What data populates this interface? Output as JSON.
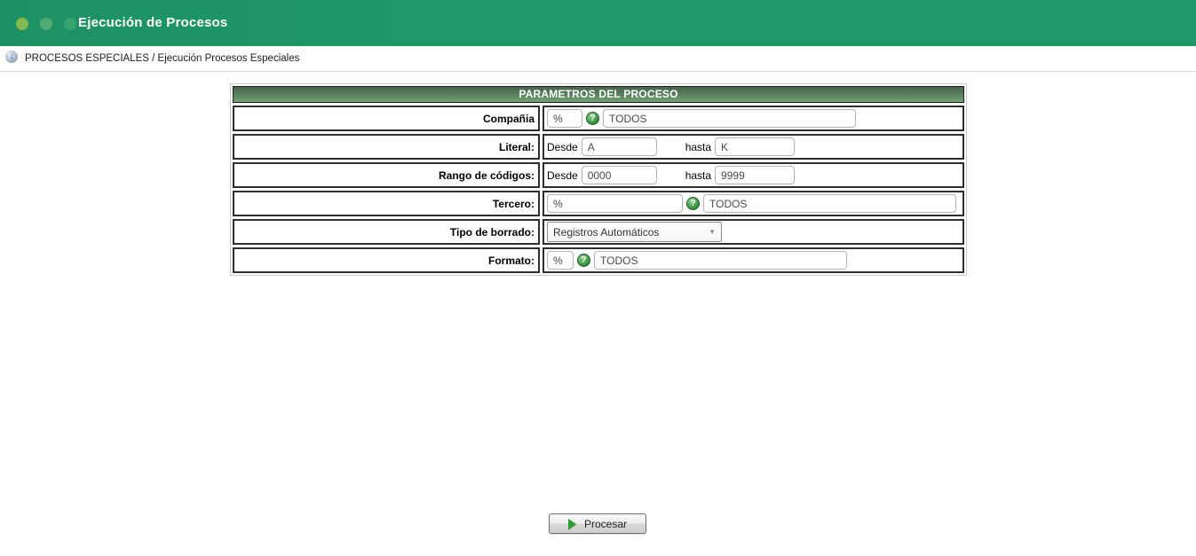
{
  "header": {
    "title": "Ejecución de Procesos"
  },
  "breadcrumb": {
    "text": "PROCESOS ESPECIALES / Ejecución Procesos Especiales"
  },
  "panel": {
    "title": "PARAMETROS DEL PROCESO",
    "rows": {
      "compania": {
        "label": "Compañia",
        "code": "%",
        "desc": "TODOS"
      },
      "literal": {
        "label": "Literal:",
        "desde_label": "Desde",
        "desde": "A",
        "hasta_label": "hasta",
        "hasta": "K"
      },
      "rango": {
        "label": "Rango de códigos:",
        "desde_label": "Desde",
        "desde": "0000",
        "hasta_label": "hasta",
        "hasta": "9999"
      },
      "tercero": {
        "label": "Tercero:",
        "code": "%",
        "desc": "TODOS"
      },
      "tipo_borrado": {
        "label": "Tipo de borrado:",
        "value": "Registros Automáticos"
      },
      "formato": {
        "label": "Formato:",
        "code": "%",
        "desc": "TODOS"
      }
    }
  },
  "icons": {
    "help": "?",
    "select_arrow": "▼",
    "breadcrumb_arrow": "↓"
  },
  "actions": {
    "process": "Procesar"
  },
  "colors": {
    "header_green": "#1f9768",
    "panel_header_top": "#47664b",
    "panel_header_bottom": "#74a577",
    "accent_green": "#2ea12c"
  }
}
